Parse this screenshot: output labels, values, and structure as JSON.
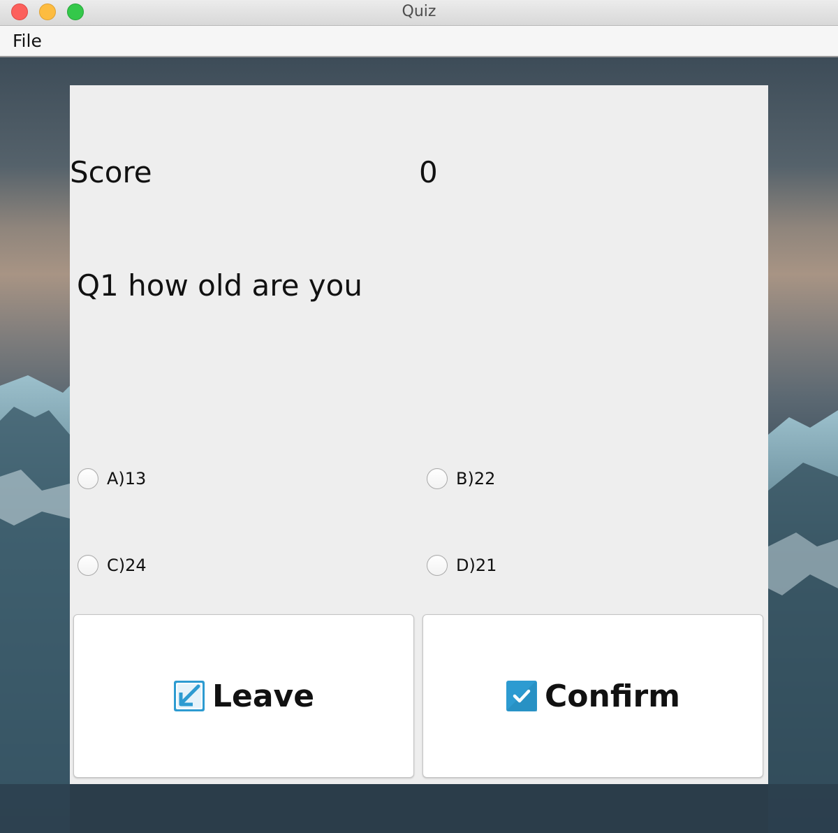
{
  "window": {
    "title": "Quiz",
    "controls": [
      "close",
      "minimize",
      "maximize"
    ]
  },
  "menubar": {
    "items": [
      {
        "label": "File"
      }
    ]
  },
  "quiz": {
    "score_label": "Score",
    "score_value": "0",
    "question": "Q1 how old are you",
    "options": [
      {
        "label": "A)13",
        "selected": false
      },
      {
        "label": "B)22",
        "selected": false
      },
      {
        "label": "C)24",
        "selected": false
      },
      {
        "label": "D)21",
        "selected": false
      }
    ]
  },
  "buttons": {
    "leave_label": "Leave",
    "leave_icon": "exit-arrow-icon",
    "confirm_label": "Confirm",
    "confirm_icon": "checkbox-check-icon"
  },
  "colors": {
    "panel": "#eeeeee",
    "accent_icon": "#2d9bd1"
  }
}
